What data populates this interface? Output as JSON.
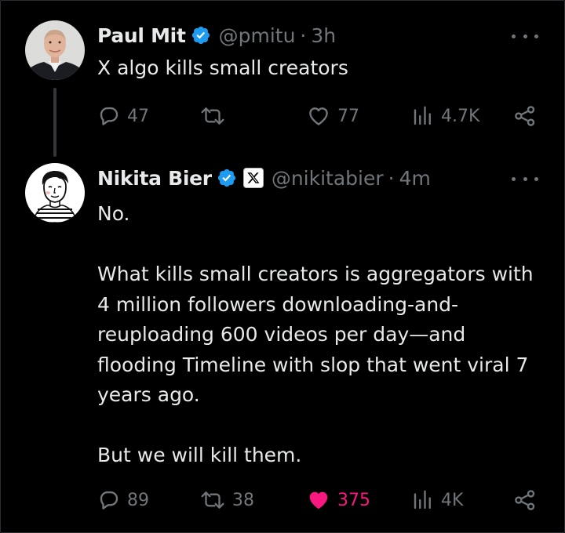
{
  "colors": {
    "background": "#000000",
    "text": "#e7e9ea",
    "muted": "#71767b",
    "verified": "#1d9bf0",
    "like_active": "#f91880"
  },
  "tweets": [
    {
      "name": "Paul Mit",
      "verified": true,
      "handle": "@pmitu",
      "separator": "·",
      "time": "3h",
      "text": "X algo kills small creators",
      "actions": {
        "replies": "47",
        "reposts": "",
        "likes": "77",
        "liked": false,
        "views": "4.7K"
      }
    },
    {
      "name": "Nikita Bier",
      "verified": true,
      "affiliation_badge": "x-logo-icon",
      "handle": "@nikitabier",
      "separator": "·",
      "time": "4m",
      "text": "No.\n\nWhat kills small creators is aggregators with 4 million followers downloading-and-reuploading 600 videos per day—and flooding Timeline with slop that went viral 7 years ago.\n\nBut we will kill them.",
      "actions": {
        "replies": "89",
        "reposts": "38",
        "likes": "375",
        "liked": true,
        "views": "4K"
      }
    }
  ]
}
